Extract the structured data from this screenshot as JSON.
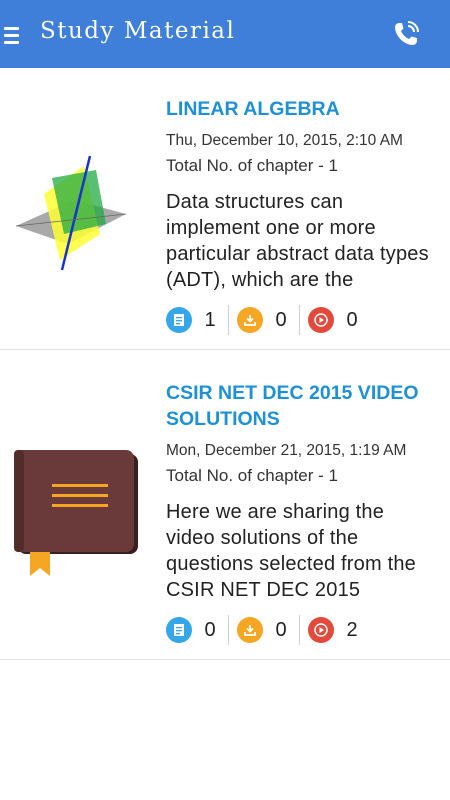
{
  "header": {
    "title": "Study Material",
    "menu_icon": "hamburger-menu-icon",
    "call_icon": "phone-call-icon",
    "bg_color": "#3f7fd9"
  },
  "materials": [
    {
      "title": "LINEAR ALGEBRA",
      "date": "Thu, December 10, 2015, 2:10 AM",
      "chapters": "Total No. of chapter - 1",
      "description": "Data structures can implement one or more particular abstract data types (ADT), which are the",
      "thumbnail": "linear-algebra-planes-image",
      "stats": {
        "notes": "1",
        "downloads": "0",
        "videos": "0"
      }
    },
    {
      "title": "CSIR NET DEC 2015 VIDEO SOLUTIONS",
      "date": "Mon, December 21, 2015, 1:19 AM",
      "chapters": "Total No. of chapter - 1",
      "description": "Here we are sharing the video solutions of the questions selected from the CSIR NET DEC 2015",
      "thumbnail": "brown-book-image",
      "stats": {
        "notes": "0",
        "downloads": "0",
        "videos": "2"
      }
    }
  ],
  "colors": {
    "title": "#1e90d6",
    "notes_icon": "#35a7e8",
    "download_icon": "#f5a623",
    "video_icon": "#e24b3b"
  }
}
